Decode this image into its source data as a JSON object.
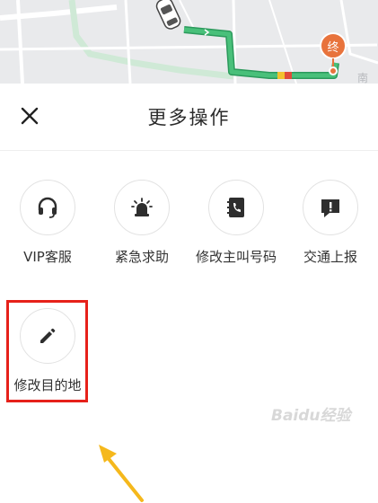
{
  "map": {
    "end_marker_label": "终",
    "road_label": "南"
  },
  "header": {
    "title": "更多操作"
  },
  "actions": [
    {
      "label": "VIP客服",
      "icon": "headset-icon"
    },
    {
      "label": "紧急求助",
      "icon": "alarm-siren-icon"
    },
    {
      "label": "修改主叫号码",
      "icon": "phone-book-icon"
    },
    {
      "label": "交通上报",
      "icon": "report-icon"
    },
    {
      "label": "修改目的地",
      "icon": "edit-pencil-icon"
    }
  ],
  "annotation": {
    "highlight_color": "#e6211a",
    "arrow_color": "#f5b81c"
  },
  "watermark": {
    "text": "Baidu经验"
  }
}
